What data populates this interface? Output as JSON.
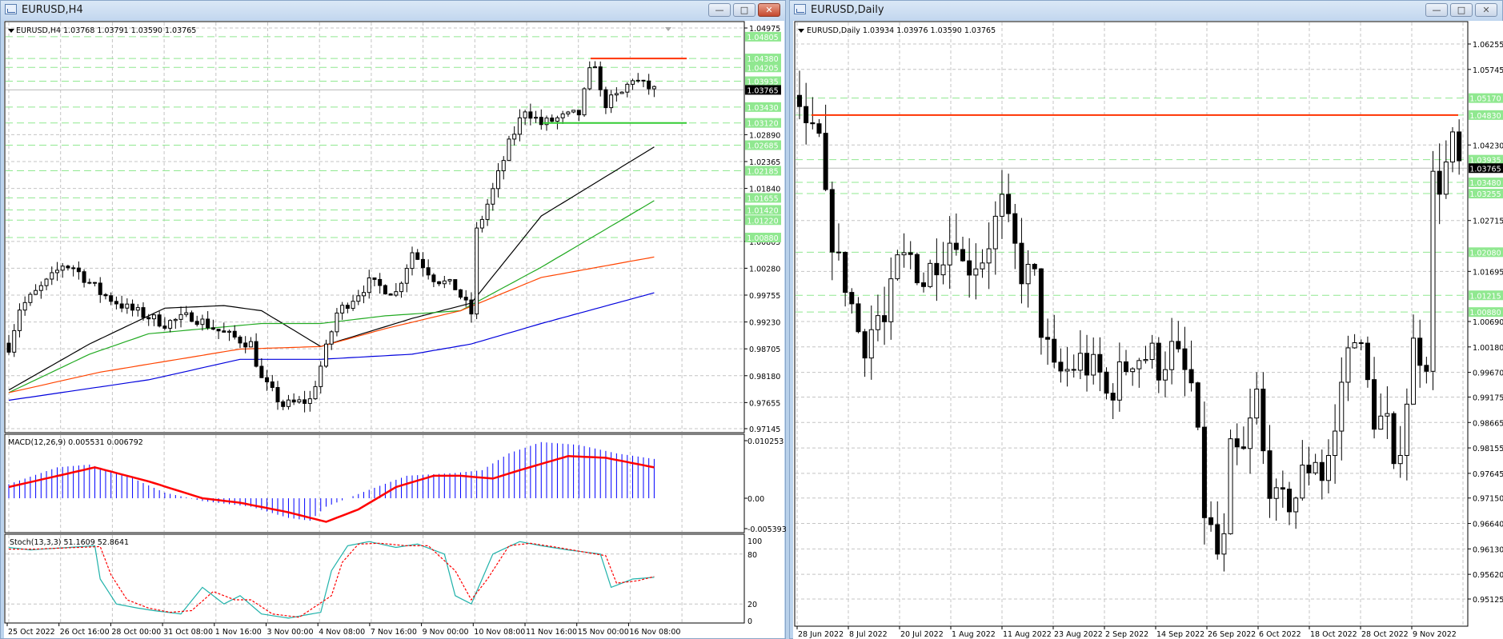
{
  "left_window": {
    "title": "EURUSD,H4",
    "buttons": {
      "minimize": "—",
      "restore": "□",
      "close": "✕"
    },
    "header": "EURUSD,H4  1.03768 1.03791 1.03590 1.03765",
    "macd_label": "MACD(12,26,9) 0.005531 0.006792",
    "stoch_label": "Stoch(13,3,3) 51.1609 52.8641"
  },
  "right_window": {
    "title": "EURUSD,Daily",
    "buttons": {
      "minimize": "—",
      "restore": "□",
      "close": "✕"
    },
    "header": "EURUSD,Daily  1.03934 1.03976 1.03590 1.03765"
  },
  "colors": {
    "bull": "#ffffff",
    "bear": "#000000",
    "level": "#90e890",
    "red_line": "#ff3300",
    "green_line": "#33cc33",
    "ma_black": "#000000",
    "ma_green": "#22aa22",
    "ma_orange": "#ff4400",
    "ma_blue": "#0000dd",
    "macd_hist": "#0000ff",
    "macd_signal": "#ff0000",
    "stoch_main": "#20b2aa",
    "stoch_signal": "#ff0000"
  },
  "chart_data": [
    {
      "type": "candlestick",
      "title": "EURUSD,H4",
      "candle_count": 121,
      "close_path": [
        [
          0,
          0.9875
        ],
        [
          2,
          0.995
        ],
        [
          8,
          1.001
        ],
        [
          10,
          1.0035
        ],
        [
          12,
          1.003
        ],
        [
          17,
          0.998
        ],
        [
          22,
          0.995
        ],
        [
          29,
          0.992
        ],
        [
          34,
          0.9935
        ],
        [
          40,
          0.99
        ],
        [
          45,
          0.988
        ],
        [
          47,
          0.981
        ],
        [
          51,
          0.976
        ],
        [
          56,
          0.977
        ],
        [
          59,
          0.987
        ],
        [
          61,
          0.994
        ],
        [
          67,
          1.0
        ],
        [
          72,
          0.998
        ],
        [
          75,
          1.006
        ],
        [
          79,
          1.001
        ],
        [
          83,
          0.999
        ],
        [
          86,
          0.994
        ],
        [
          87,
          1.01
        ],
        [
          90,
          1.018
        ],
        [
          93,
          1.027
        ],
        [
          96,
          1.034
        ],
        [
          99,
          1.031
        ],
        [
          102,
          1.032
        ],
        [
          106,
          1.033
        ],
        [
          108,
          1.041
        ],
        [
          109,
          1.043
        ],
        [
          110,
          1.037
        ],
        [
          111,
          1.035
        ],
        [
          114,
          1.037
        ],
        [
          116,
          1.04
        ],
        [
          118,
          1.0385
        ],
        [
          120,
          1.03765
        ]
      ],
      "y_ticks": [
        "1.04975",
        "1.02890",
        "1.02365",
        "1.01840",
        "1.00805",
        "1.00280",
        "0.99755",
        "0.99230",
        "0.98705",
        "0.98180",
        "0.97655",
        "0.97145"
      ],
      "ylim": [
        0.97145,
        1.04975
      ],
      "levels": [
        "1.04805",
        "1.04380",
        "1.04205",
        "1.03935",
        "1.03430",
        "1.03120",
        "1.02685",
        "1.02185",
        "1.01655",
        "1.01420",
        "1.01220",
        "1.00880"
      ],
      "current_price": "1.03765",
      "resistance": 1.0438,
      "support": 1.0312,
      "moving_averages": [
        {
          "name": "ma-black",
          "path": [
            [
              0,
              0.979
            ],
            [
              15,
              0.988
            ],
            [
              29,
              0.995
            ],
            [
              40,
              0.9955
            ],
            [
              47,
              0.9945
            ],
            [
              58,
              0.9875
            ],
            [
              75,
              0.993
            ],
            [
              86,
              0.996
            ],
            [
              99,
              1.013
            ],
            [
              120,
              1.0265
            ]
          ]
        },
        {
          "name": "ma-green",
          "path": [
            [
              0,
              0.9785
            ],
            [
              15,
              0.986
            ],
            [
              26,
              0.99
            ],
            [
              47,
              0.992
            ],
            [
              58,
              0.992
            ],
            [
              70,
              0.9935
            ],
            [
              84,
              0.9945
            ],
            [
              99,
              1.003
            ],
            [
              120,
              1.016
            ]
          ]
        },
        {
          "name": "ma-orange",
          "path": [
            [
              0,
              0.9785
            ],
            [
              17,
              0.9825
            ],
            [
              43,
              0.987
            ],
            [
              58,
              0.9875
            ],
            [
              70,
              0.991
            ],
            [
              84,
              0.9945
            ],
            [
              99,
              1.001
            ],
            [
              120,
              1.005
            ]
          ]
        },
        {
          "name": "ma-blue",
          "path": [
            [
              0,
              0.977
            ],
            [
              26,
              0.981
            ],
            [
              43,
              0.985
            ],
            [
              58,
              0.985
            ],
            [
              75,
              0.986
            ],
            [
              86,
              0.988
            ],
            [
              99,
              0.992
            ],
            [
              120,
              0.998
            ]
          ]
        }
      ],
      "time_labels": [
        "25 Oct 2022",
        "26 Oct 16:00",
        "28 Oct 00:00",
        "31 Oct 08:00",
        "1 Nov 16:00",
        "3 Nov 00:00",
        "4 Nov 08:00",
        "7 Nov 16:00",
        "9 Nov 00:00",
        "10 Nov 08:00",
        "11 Nov 16:00",
        "15 Nov 00:00",
        "16 Nov 08:00"
      ]
    },
    {
      "type": "bar",
      "title": "MACD(12,26,9)",
      "hist_path": [
        [
          0,
          0.0025
        ],
        [
          9,
          0.0055
        ],
        [
          15,
          0.006
        ],
        [
          22,
          0.004
        ],
        [
          29,
          0.001
        ],
        [
          36,
          -0.0005
        ],
        [
          45,
          -0.0015
        ],
        [
          52,
          -0.0035
        ],
        [
          56,
          -0.004
        ],
        [
          59,
          -0.0015
        ],
        [
          67,
          0.0015
        ],
        [
          74,
          0.004
        ],
        [
          83,
          0.0045
        ],
        [
          88,
          0.005
        ],
        [
          93,
          0.008
        ],
        [
          99,
          0.01
        ],
        [
          106,
          0.0095
        ],
        [
          113,
          0.008
        ],
        [
          120,
          0.007
        ]
      ],
      "signal_path": [
        [
          0,
          0.002
        ],
        [
          16,
          0.0055
        ],
        [
          26,
          0.003
        ],
        [
          36,
          0.0
        ],
        [
          43,
          -0.0008
        ],
        [
          52,
          -0.0025
        ],
        [
          59,
          -0.0042
        ],
        [
          65,
          -0.002
        ],
        [
          72,
          0.002
        ],
        [
          79,
          0.004
        ],
        [
          84,
          0.004
        ],
        [
          90,
          0.0035
        ],
        [
          95,
          0.005
        ],
        [
          104,
          0.0075
        ],
        [
          111,
          0.0072
        ],
        [
          120,
          0.0055
        ]
      ],
      "y_ticks": [
        "0.010253",
        "0.00",
        "-0.005393"
      ],
      "ylim": [
        -0.005393,
        0.010253
      ]
    },
    {
      "type": "line",
      "title": "Stoch(13,3,3)",
      "main_path": [
        [
          0,
          88
        ],
        [
          4,
          85
        ],
        [
          16,
          90
        ],
        [
          17,
          50
        ],
        [
          20,
          20
        ],
        [
          24,
          15
        ],
        [
          27,
          12
        ],
        [
          32,
          8
        ],
        [
          36,
          40
        ],
        [
          40,
          20
        ],
        [
          43,
          30
        ],
        [
          47,
          8
        ],
        [
          52,
          3
        ],
        [
          58,
          10
        ],
        [
          60,
          60
        ],
        [
          63,
          90
        ],
        [
          67,
          95
        ],
        [
          72,
          88
        ],
        [
          76,
          92
        ],
        [
          81,
          80
        ],
        [
          83,
          30
        ],
        [
          86,
          20
        ],
        [
          90,
          80
        ],
        [
          95,
          95
        ],
        [
          99,
          90
        ],
        [
          104,
          85
        ],
        [
          110,
          80
        ],
        [
          112,
          40
        ],
        [
          116,
          50
        ],
        [
          120,
          52
        ]
      ],
      "signal_path": [
        [
          0,
          86
        ],
        [
          5,
          86
        ],
        [
          17,
          89
        ],
        [
          19,
          55
        ],
        [
          22,
          25
        ],
        [
          26,
          15
        ],
        [
          30,
          10
        ],
        [
          34,
          12
        ],
        [
          38,
          35
        ],
        [
          42,
          25
        ],
        [
          45,
          25
        ],
        [
          49,
          8
        ],
        [
          54,
          4
        ],
        [
          60,
          30
        ],
        [
          62,
          70
        ],
        [
          65,
          92
        ],
        [
          69,
          93
        ],
        [
          74,
          90
        ],
        [
          78,
          90
        ],
        [
          83,
          60
        ],
        [
          86,
          25
        ],
        [
          89,
          50
        ],
        [
          93,
          90
        ],
        [
          97,
          93
        ],
        [
          102,
          88
        ],
        [
          111,
          78
        ],
        [
          113,
          45
        ],
        [
          117,
          48
        ],
        [
          120,
          53
        ]
      ],
      "y_ticks": [
        "100",
        "80",
        "20",
        "0"
      ],
      "ylim": [
        0,
        100
      ]
    },
    {
      "type": "candlestick",
      "title": "EURUSD,Daily",
      "candle_count": 102,
      "close_path": [
        [
          0,
          1.05
        ],
        [
          1,
          1.044
        ],
        [
          3,
          1.043
        ],
        [
          4,
          1.03
        ],
        [
          6,
          1.018
        ],
        [
          7,
          1.015
        ],
        [
          9,
          1.005
        ],
        [
          10,
          1.003
        ],
        [
          12,
          1.008
        ],
        [
          13,
          1.006
        ],
        [
          15,
          1.018
        ],
        [
          17,
          1.02
        ],
        [
          19,
          1.015
        ],
        [
          21,
          1.02
        ],
        [
          24,
          1.025
        ],
        [
          25,
          1.018
        ],
        [
          28,
          1.02
        ],
        [
          31,
          1.03
        ],
        [
          32,
          1.025
        ],
        [
          34,
          1.017
        ],
        [
          36,
          1.015
        ],
        [
          37,
          1.006
        ],
        [
          39,
          0.996
        ],
        [
          41,
          0.997
        ],
        [
          43,
          0.999
        ],
        [
          46,
          0.996
        ],
        [
          47,
          0.992
        ],
        [
          49,
          0.996
        ],
        [
          51,
          1.0
        ],
        [
          54,
          1.0
        ],
        [
          55,
          0.998
        ],
        [
          57,
          1.001
        ],
        [
          60,
          0.994
        ],
        [
          61,
          0.982
        ],
        [
          62,
          0.969
        ],
        [
          64,
          0.96
        ],
        [
          65,
          0.962
        ],
        [
          66,
          0.98
        ],
        [
          68,
          0.98
        ],
        [
          70,
          0.992
        ],
        [
          71,
          0.98
        ],
        [
          73,
          0.97
        ],
        [
          74,
          0.97
        ],
        [
          76,
          0.972
        ],
        [
          77,
          0.976
        ],
        [
          79,
          0.98
        ],
        [
          80,
          0.976
        ],
        [
          82,
          0.984
        ],
        [
          83,
          0.995
        ],
        [
          85,
          1.006
        ],
        [
          87,
          0.994
        ],
        [
          88,
          0.988
        ],
        [
          90,
          0.986
        ],
        [
          91,
          0.975
        ],
        [
          93,
          0.992
        ],
        [
          94,
          1.002
        ],
        [
          96,
          1.0
        ],
        [
          97,
          1.035
        ],
        [
          98,
          1.035
        ],
        [
          99,
          1.038
        ],
        [
          100,
          1.042
        ],
        [
          101,
          1.03765
        ]
      ],
      "y_ticks": [
        "1.06255",
        "1.05745",
        "1.04230",
        "1.02715",
        "1.01695",
        "1.00690",
        "1.00180",
        "0.99670",
        "0.99175",
        "0.98665",
        "0.98155",
        "0.97645",
        "0.97150",
        "0.96640",
        "0.96130",
        "0.95620",
        "0.95125"
      ],
      "ylim": [
        0.95125,
        1.06255
      ],
      "levels": [
        "1.05170",
        "1.04830",
        "1.03935",
        "1.03480",
        "1.03255",
        "1.02080",
        "1.01215",
        "1.00880"
      ],
      "current_price": "1.03765",
      "resistance": 1.0483,
      "time_labels": [
        "28 Jun 2022",
        "8 Jul 2022",
        "20 Jul 2022",
        "1 Aug 2022",
        "11 Aug 2022",
        "23 Aug 2022",
        "2 Sep 2022",
        "14 Sep 2022",
        "26 Sep 2022",
        "6 Oct 2022",
        "18 Oct 2022",
        "28 Oct 2022",
        "9 Nov 2022"
      ]
    }
  ]
}
